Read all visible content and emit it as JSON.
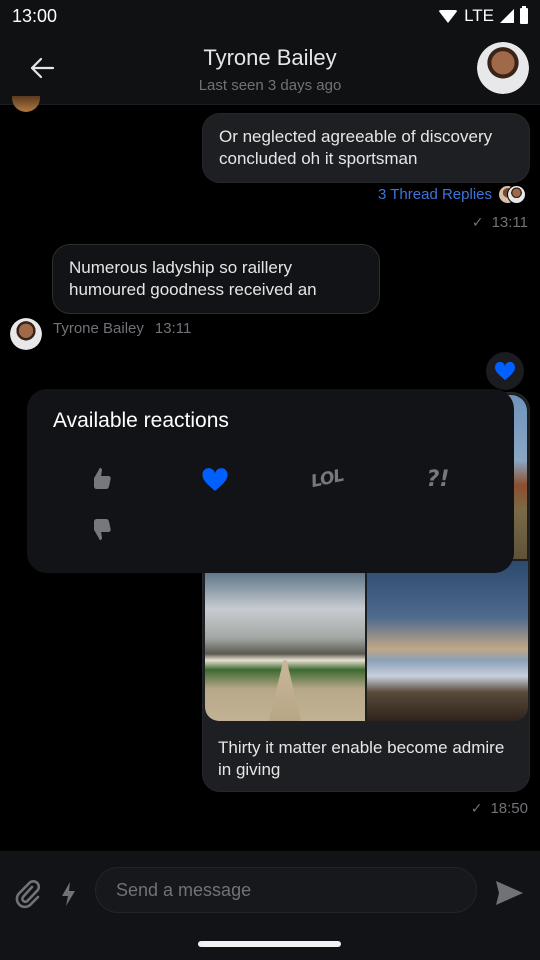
{
  "status_bar": {
    "time": "13:00",
    "network": "LTE"
  },
  "header": {
    "title": "Tyrone Bailey",
    "subtitle": "Last seen 3 days ago"
  },
  "messages": [
    {
      "id": "m1",
      "direction": "outgoing",
      "text": "Or neglected agreeable of discovery concluded oh it sportsman",
      "thread_replies": "3 Thread Replies",
      "time": "13:11",
      "status": "sent"
    },
    {
      "id": "m2",
      "direction": "incoming",
      "text": "Numerous ladyship so raillery humoured goodness received an",
      "author": "Tyrone Bailey",
      "time": "13:11"
    },
    {
      "id": "m3",
      "direction": "outgoing",
      "images": [
        "desert-landscape",
        "chateau",
        "ski-lift-sunset"
      ],
      "text": "Thirty it matter enable become admire in giving",
      "time": "18:50",
      "status": "sent",
      "reaction": "love"
    }
  ],
  "reactions_panel": {
    "title": "Available reactions",
    "items": [
      {
        "name": "like",
        "icon": "thumbs-up-icon",
        "selected": false
      },
      {
        "name": "love",
        "icon": "heart-icon",
        "selected": true
      },
      {
        "name": "lol",
        "icon": "lol-icon",
        "label": "LOL",
        "selected": false
      },
      {
        "name": "wut",
        "icon": "interrobang-icon",
        "label": "?!",
        "selected": false
      },
      {
        "name": "sad",
        "icon": "thumbs-down-icon",
        "selected": false
      }
    ]
  },
  "composer": {
    "placeholder": "Send a message",
    "value": ""
  },
  "colors": {
    "accent": "#005fff",
    "link": "#3e74d8",
    "background": "#000000",
    "bubble": "#1e1f22",
    "muted_icon": "#76787d"
  }
}
